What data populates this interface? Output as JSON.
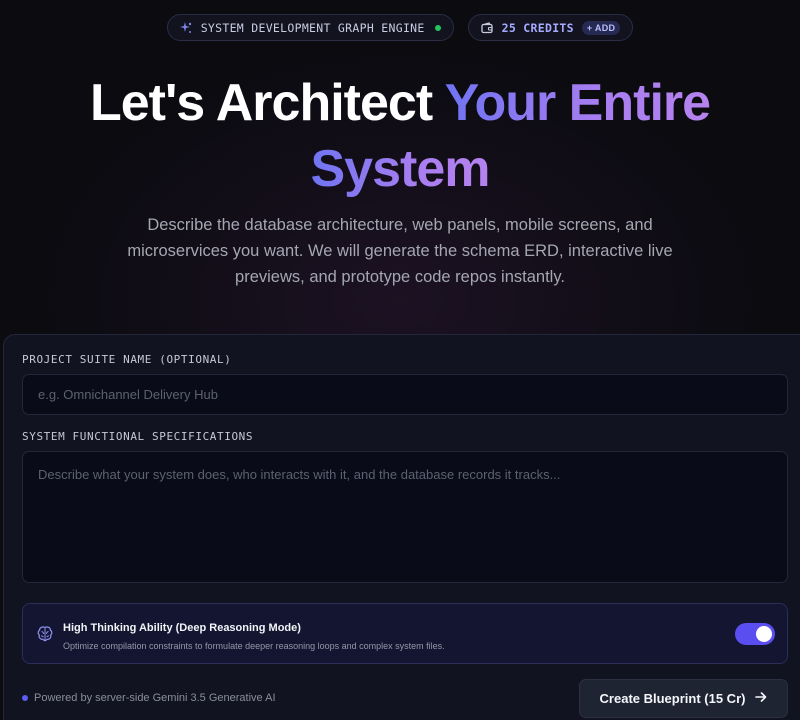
{
  "topbar": {
    "engine_label": "SYSTEM DEVELOPMENT GRAPH ENGINE",
    "credits_label": "25 CREDITS",
    "add_label": "+ ADD",
    "status_color": "#22c55e"
  },
  "hero": {
    "title_white": "Let's Architect ",
    "title_gradient_line1": "Your Entire",
    "title_gradient_line2": "System",
    "subtitle": "Describe the database architecture, web panels, mobile screens, and microservices you want. We will generate the schema ERD, interactive live previews, and prototype code repos instantly."
  },
  "form": {
    "project_label": "PROJECT SUITE NAME (OPTIONAL)",
    "project_placeholder": "e.g. Omnichannel Delivery Hub",
    "project_value": "",
    "spec_label": "SYSTEM FUNCTIONAL SPECIFICATIONS",
    "spec_placeholder": "Describe what your system does, who interacts with it, and the database records it tracks...",
    "spec_value": ""
  },
  "thinking": {
    "title": "High Thinking Ability (Deep Reasoning Mode)",
    "description": "Optimize compilation constraints to formulate deeper reasoning loops and complex system files.",
    "enabled": true,
    "icon": "brain-icon"
  },
  "footer": {
    "powered_text": "Powered by server-side Gemini 3.5 Generative AI",
    "create_button": "Create Blueprint (15 Cr)",
    "accent": "#5b4ef0"
  }
}
